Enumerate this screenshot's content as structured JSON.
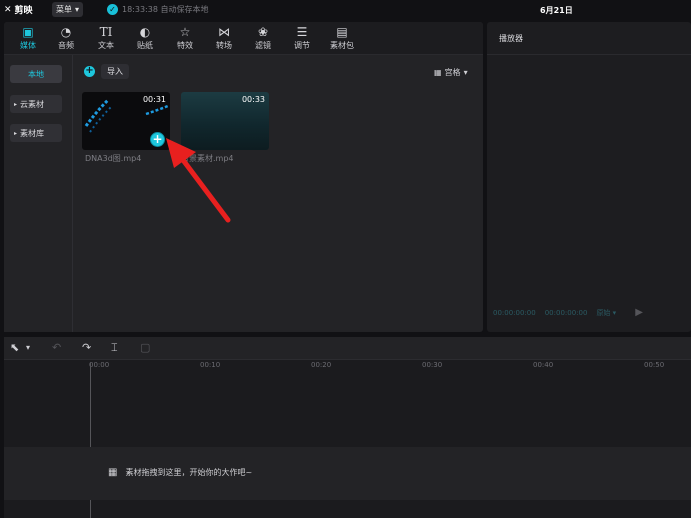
{
  "titlebar": {
    "app_name": "剪映",
    "menu_label": "菜单",
    "save_status": "18:33:38 自动保存本地",
    "date": "6月21日"
  },
  "toolbar": {
    "items": [
      {
        "label": "媒体",
        "icon": "media-icon"
      },
      {
        "label": "音频",
        "icon": "audio-icon"
      },
      {
        "label": "文本",
        "icon": "text-icon"
      },
      {
        "label": "贴纸",
        "icon": "sticker-icon"
      },
      {
        "label": "特效",
        "icon": "effects-icon"
      },
      {
        "label": "转场",
        "icon": "transition-icon"
      },
      {
        "label": "滤镜",
        "icon": "filter-icon"
      },
      {
        "label": "调节",
        "icon": "adjust-icon"
      },
      {
        "label": "素材包",
        "icon": "package-icon"
      }
    ],
    "active": "媒体"
  },
  "sidebar": {
    "items": [
      {
        "label": "本地"
      },
      {
        "label": "云素材"
      },
      {
        "label": "素材库"
      }
    ]
  },
  "media": {
    "import_label": "导入",
    "view_label": "宫格",
    "files": [
      {
        "name": "DNA3d图.mp4",
        "duration": "00:31"
      },
      {
        "name": "背景素材.mp4",
        "duration": "00:33"
      }
    ]
  },
  "player": {
    "title": "播放器",
    "time_current": "00:00:00:00",
    "time_total": "00:00:00:00",
    "ratio_label": "原始"
  },
  "timeline": {
    "ticks": [
      "00:00",
      "00:10",
      "00:20",
      "00:30",
      "00:40",
      "00:50"
    ],
    "drop_hint": "素材拖拽到这里，开始你的大作吧~"
  },
  "colors": {
    "accent": "#1ec7dd",
    "arrow": "#e8201f"
  }
}
